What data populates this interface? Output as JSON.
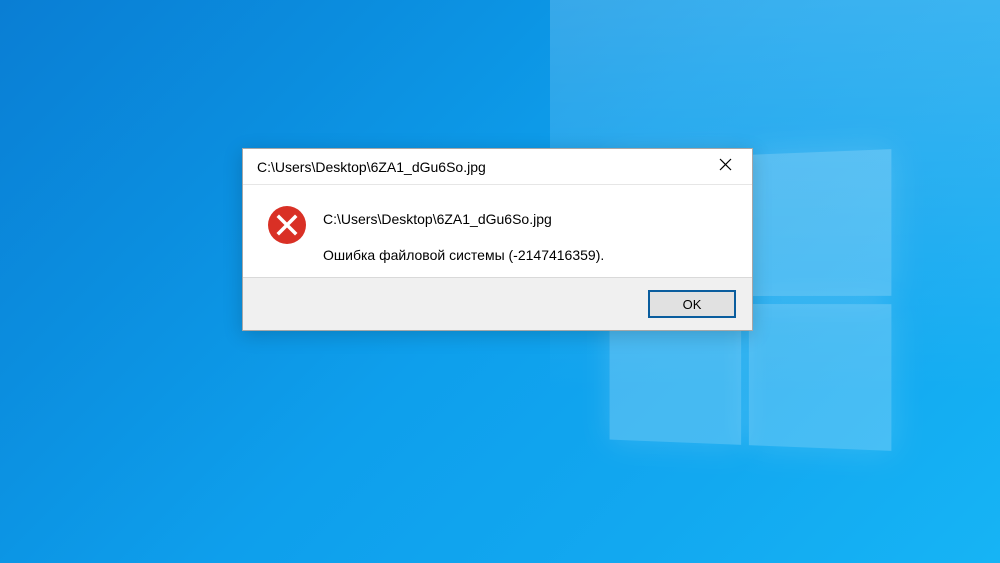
{
  "dialog": {
    "title": "C:\\Users\\Desktop\\6ZA1_dGu6So.jpg",
    "message_path": "C:\\Users\\Desktop\\6ZA1_dGu6So.jpg",
    "error_text": "Ошибка файловой системы (-2147416359).",
    "ok_label": "OK"
  },
  "icons": {
    "close": "close-icon",
    "error": "error-x-icon"
  }
}
